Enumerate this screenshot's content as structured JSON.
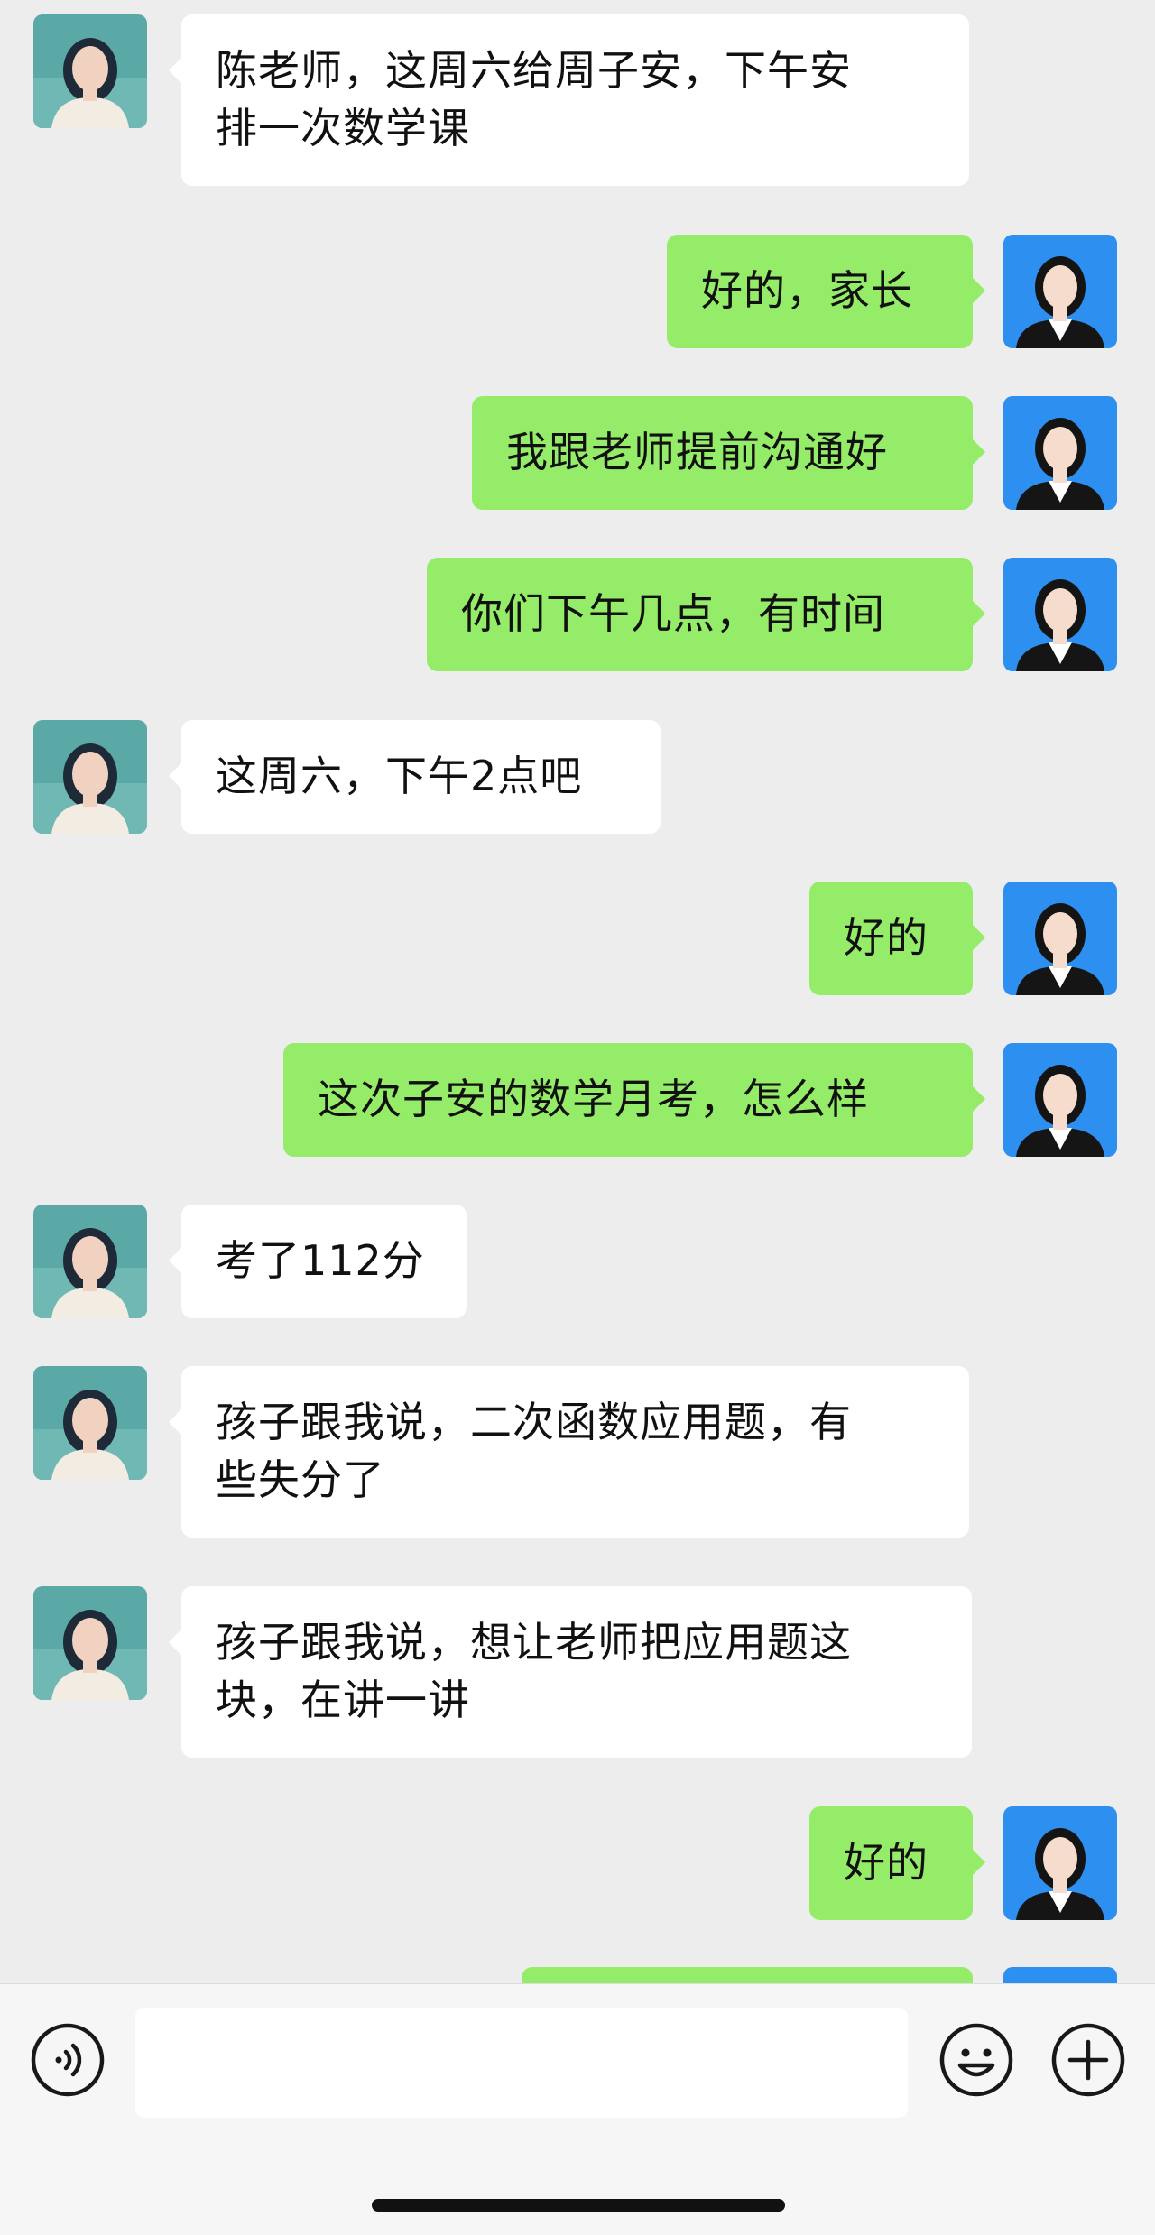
{
  "messages": [
    {
      "side": "left",
      "sender": "parent",
      "text": "陈老师，这周六给周子安，下午安\n排一次数学课"
    },
    {
      "side": "right",
      "sender": "self",
      "text": "好的，家长"
    },
    {
      "side": "right",
      "sender": "self",
      "text": "我跟老师提前沟通好"
    },
    {
      "side": "right",
      "sender": "self",
      "text": "你们下午几点，有时间"
    },
    {
      "side": "left",
      "sender": "parent",
      "text": "这周六，下午2点吧"
    },
    {
      "side": "right",
      "sender": "self",
      "text": "好的"
    },
    {
      "side": "right",
      "sender": "self",
      "text": "这次子安的数学月考，怎么样"
    },
    {
      "side": "left",
      "sender": "parent",
      "text": "考了112分"
    },
    {
      "side": "left",
      "sender": "parent",
      "text": "孩子跟我说，二次函数应用题，有\n些失分了"
    },
    {
      "side": "left",
      "sender": "parent",
      "text": "孩子跟我说，想让老师把应用题这\n块，在讲一讲"
    },
    {
      "side": "right",
      "sender": "self",
      "text": "好的"
    },
    {
      "side": "right",
      "sender": "self",
      "text": ""
    }
  ],
  "input_bar": {
    "placeholder": "",
    "voice_icon": "voice-icon",
    "emoji_icon": "emoji-icon",
    "plus_icon": "plus-icon"
  },
  "colors": {
    "background": "#ededed",
    "bubble_self": "#95ec69",
    "bubble_other": "#ffffff"
  }
}
